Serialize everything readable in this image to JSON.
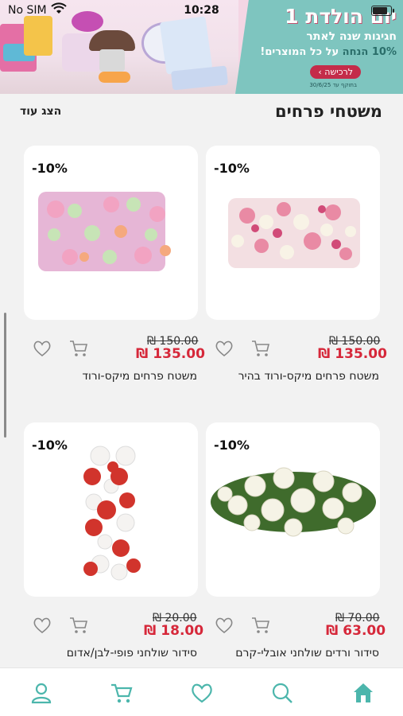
{
  "status_bar": {
    "carrier": "No SIM",
    "time": "10:28"
  },
  "banner": {
    "title": "יום הולדת 1",
    "subtitle": "חגיגות שנה לאתר",
    "offer_discount": "10% הנחה",
    "offer_rest": "על כל המוצרים!",
    "cta_label": "לרכישה",
    "validity": "בתוקף עד 30/6/25"
  },
  "section": {
    "title": "משטחי פרחים",
    "show_more": "הצג עוד"
  },
  "products": [
    {
      "name": "משטח פרחים מיקס-ורוד בהיר",
      "old_price": "₪ 150.00",
      "price": "₪ 135.00",
      "discount": "-10%"
    },
    {
      "name": "משטח פרחים מיקס-ורוד",
      "old_price": "₪ 150.00",
      "price": "₪ 135.00",
      "discount": "-10%"
    },
    {
      "name": "סידור ורדים שולחני אובלי-קרם",
      "old_price": "₪ 70.00",
      "price": "₪ 63.00",
      "discount": "-10%"
    },
    {
      "name": "סידור שולחני פופי-לבן/אדום",
      "old_price": "₪ 20.00",
      "price": "₪ 18.00",
      "discount": "-10%"
    }
  ],
  "nav": {
    "items": [
      "home-icon",
      "search-icon",
      "heart-icon",
      "cart-icon",
      "user-icon"
    ]
  },
  "colors": {
    "accent": "#4cb6ac",
    "price": "#d6283a",
    "promo_bg": "#7ec5bf",
    "cta": "#c42c4a"
  }
}
